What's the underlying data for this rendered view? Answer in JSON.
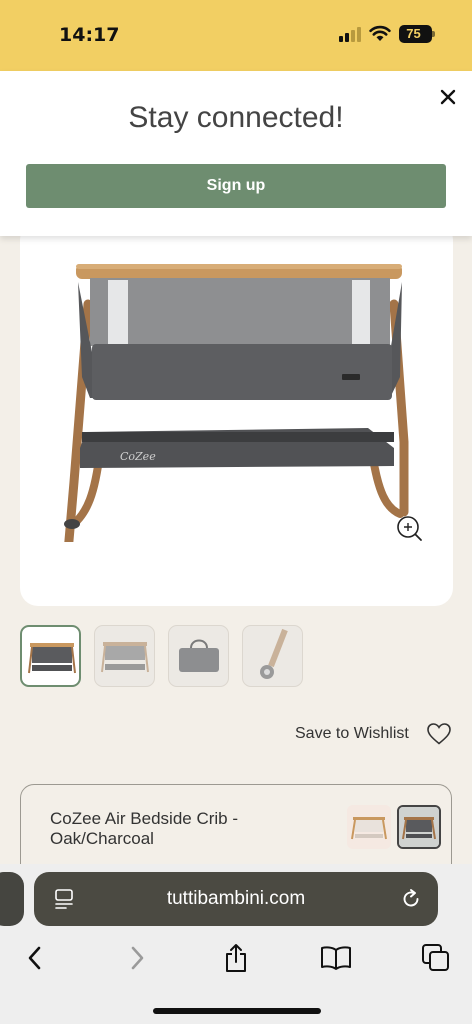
{
  "status_bar": {
    "time": "14:17",
    "battery_level": "75",
    "signal_bars_active": 2,
    "signal_bars_total": 4
  },
  "banner": {
    "title": "Stay connected!",
    "signup_label": "Sign up",
    "close_icon": "close-icon",
    "button_color": "#6e8d70",
    "background_color": "#ffffff"
  },
  "product": {
    "brand_mark": "CoZee",
    "thumbnail_count": 4,
    "selected_thumbnail": 1,
    "zoom_icon": "zoom-in-icon"
  },
  "wishlist": {
    "label": "Save to Wishlist",
    "icon": "heart-icon"
  },
  "product_bar": {
    "title": "CoZee Air Bedside Crib - Oak/Charcoal",
    "variants": [
      "Oak/White",
      "Oak/Charcoal"
    ],
    "selected_variant": "Oak/Charcoal"
  },
  "browser": {
    "url": "tuttibambini.com",
    "toolbar_icons": [
      "back-icon",
      "forward-icon",
      "share-icon",
      "bookmarks-icon",
      "tabs-icon"
    ]
  },
  "colors": {
    "status_bar": "#f2cf63",
    "page_background": "#f3efe8",
    "accent_green": "#6e8d70",
    "url_bar": "#4b4a42"
  }
}
